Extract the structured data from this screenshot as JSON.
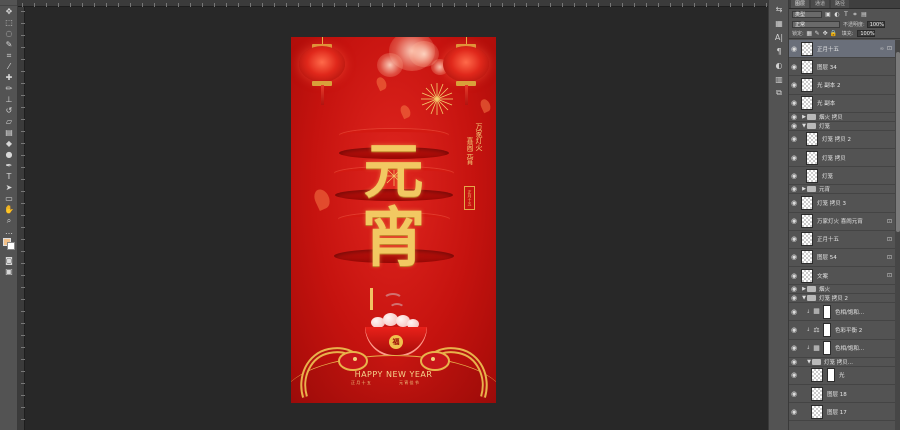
{
  "toolbar": {
    "tools": [
      {
        "name": "move-tool",
        "glyph": "✥"
      },
      {
        "name": "marquee-tool",
        "glyph": "⬚"
      },
      {
        "name": "lasso-tool",
        "glyph": "◌"
      },
      {
        "name": "quick-select-tool",
        "glyph": "✎"
      },
      {
        "name": "crop-tool",
        "glyph": "⌗"
      },
      {
        "name": "eyedropper-tool",
        "glyph": "⁄"
      },
      {
        "name": "healing-brush-tool",
        "glyph": "✚"
      },
      {
        "name": "brush-tool",
        "glyph": "✏"
      },
      {
        "name": "clone-stamp-tool",
        "glyph": "⊥"
      },
      {
        "name": "history-brush-tool",
        "glyph": "↺"
      },
      {
        "name": "eraser-tool",
        "glyph": "▱"
      },
      {
        "name": "gradient-tool",
        "glyph": "▤"
      },
      {
        "name": "blur-tool",
        "glyph": "◆"
      },
      {
        "name": "dodge-tool",
        "glyph": "●"
      },
      {
        "name": "pen-tool",
        "glyph": "✒"
      },
      {
        "name": "type-tool",
        "glyph": "T"
      },
      {
        "name": "path-select-tool",
        "glyph": "➤"
      },
      {
        "name": "shape-tool",
        "glyph": "▭"
      },
      {
        "name": "hand-tool",
        "glyph": "✋"
      },
      {
        "name": "zoom-tool",
        "glyph": "⌕"
      },
      {
        "name": "more-tools",
        "glyph": "…"
      }
    ],
    "bottom": [
      {
        "name": "quick-mask",
        "glyph": "◙"
      },
      {
        "name": "screen-mode",
        "glyph": "▣"
      }
    ],
    "foreground_color": "#f4c28a",
    "background_color": "#ffffff"
  },
  "poster": {
    "title_top": "元",
    "title_bottom": "宵",
    "vertical_text_1": "万家灯火",
    "vertical_text_2": "喜闹元宵",
    "seal_text": "正月十五",
    "bowl_char": "福",
    "happy_new_year": "HAPPY NEW YEAR",
    "bottom_small_left": "正 月 十 五",
    "bottom_small_right": "元 宵 佳 节",
    "background": "#c6130f",
    "gold": "#f2c862"
  },
  "right_column": {
    "tabs": [
      "⇆",
      "▦",
      "A|",
      "¶",
      "◐",
      "▥",
      "⧉"
    ]
  },
  "layers_panel": {
    "tabs": [
      "图层",
      "通道",
      "路径"
    ],
    "filter_label": "类型",
    "filter_icons": [
      "▣",
      "◐",
      "T",
      "⌗",
      "▤"
    ],
    "blend_mode": "正常",
    "opacity_label": "不透明度:",
    "opacity_value": "100%",
    "lock_label": "锁定:",
    "lock_icons": [
      "▦",
      "✎",
      "✥",
      "🔒"
    ],
    "fill_label": "填充:",
    "fill_value": "100%",
    "layers": [
      {
        "name": "正月十五",
        "kind": "layer",
        "selected": true,
        "link": true,
        "lock": true
      },
      {
        "name": "图层 34",
        "kind": "layer"
      },
      {
        "name": "光 副本 2",
        "kind": "layer"
      },
      {
        "name": "光 副本",
        "kind": "layer"
      },
      {
        "name": "烟火 拷贝",
        "kind": "group",
        "collapsed": true
      },
      {
        "name": "灯笼",
        "kind": "group",
        "collapsed": false
      },
      {
        "name": "灯笼 拷贝 2",
        "kind": "layer",
        "indent": 1
      },
      {
        "name": "灯笼 拷贝",
        "kind": "layer",
        "indent": 1
      },
      {
        "name": "灯笼",
        "kind": "layer",
        "indent": 1
      },
      {
        "name": "元宵",
        "kind": "group",
        "collapsed": true
      },
      {
        "name": "灯笼 拷贝 3",
        "kind": "layer"
      },
      {
        "name": "万家灯火 喜闹元宵",
        "kind": "layer",
        "lock": true
      },
      {
        "name": "正月十五",
        "kind": "layer",
        "lock": true
      },
      {
        "name": "图层 54",
        "kind": "layer",
        "lock": true
      },
      {
        "name": "文案",
        "kind": "layer",
        "lock": true
      },
      {
        "name": "烟火",
        "kind": "group",
        "collapsed": true
      },
      {
        "name": "灯笼 拷贝 2",
        "kind": "group",
        "collapsed": false
      },
      {
        "name": "色相/饱和...",
        "kind": "adjust",
        "indent": 1,
        "icon": "▦"
      },
      {
        "name": "色彩平衡 2",
        "kind": "adjust",
        "indent": 1,
        "icon": "⚖"
      },
      {
        "name": "色相/饱和...",
        "kind": "adjust",
        "indent": 1,
        "icon": "▦"
      },
      {
        "name": "灯笼 拷贝...",
        "kind": "group",
        "collapsed": false,
        "indent": 1
      },
      {
        "name": "光",
        "kind": "layer",
        "indent": 2,
        "mask": true
      },
      {
        "name": "图层 18",
        "kind": "layer",
        "indent": 2
      },
      {
        "name": "图层 17",
        "kind": "layer",
        "indent": 2
      }
    ]
  }
}
